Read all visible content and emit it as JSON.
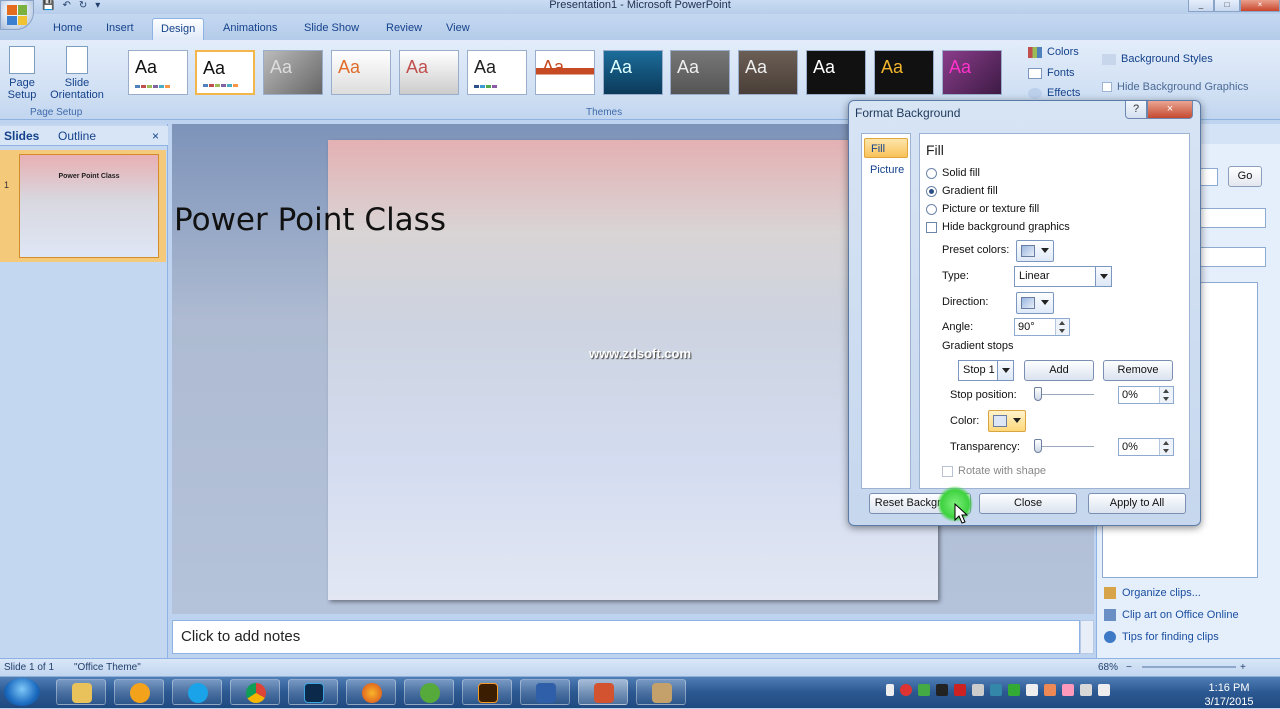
{
  "app": {
    "window_title": "Presentation1 - Microsoft PowerPoint"
  },
  "ribbon": {
    "tabs": [
      {
        "label": "Home"
      },
      {
        "label": "Insert"
      },
      {
        "label": "Design"
      },
      {
        "label": "Animations"
      },
      {
        "label": "Slide Show"
      },
      {
        "label": "Review"
      },
      {
        "label": "View"
      }
    ],
    "active_tab": "Design",
    "page_setup": {
      "page_setup_label_1": "Page",
      "page_setup_label_2": "Setup",
      "orientation_label_1": "Slide",
      "orientation_label_2": "Orientation",
      "group_label": "Page Setup"
    },
    "themes": {
      "group_label": "Themes",
      "sample_text": "Aa"
    },
    "theme_options": {
      "colors": "Colors",
      "fonts": "Fonts",
      "effects": "Effects"
    },
    "background": {
      "styles": "Background Styles",
      "hide_graphics": "Hide Background Graphics"
    }
  },
  "left_panel": {
    "tab_slides": "Slides",
    "tab_outline": "Outline",
    "close": "×",
    "slide_number": "1",
    "thumbnail_title": "Power Point Class"
  },
  "slide": {
    "title": "Power Point Class",
    "watermark": "www.zdsoft.com"
  },
  "notes": {
    "placeholder": "Click to add notes"
  },
  "right_panel": {
    "go_button": "Go",
    "links": [
      {
        "label": "Organize clips..."
      },
      {
        "label": "Clip art on Office Online"
      },
      {
        "label": "Tips for finding clips"
      }
    ]
  },
  "status_bar": {
    "slide_info": "Slide 1 of 1",
    "theme_name": "\"Office Theme\"",
    "zoom": "68%",
    "zoom_minus": "−",
    "zoom_plus": "+"
  },
  "taskbar": {
    "time": "1:16 PM",
    "date": "3/17/2015"
  },
  "dialog": {
    "title": "Format Background",
    "help": "?",
    "close_x": "×",
    "nav": [
      {
        "label": "Fill"
      },
      {
        "label": "Picture"
      }
    ],
    "fill": {
      "heading": "Fill",
      "solid_fill": "Solid fill",
      "gradient_fill": "Gradient fill",
      "picture_texture_fill": "Picture or texture fill",
      "hide_bg_graphics": "Hide background graphics",
      "selected_option": "Gradient fill",
      "preset_colors_label": "Preset colors:",
      "type_label": "Type:",
      "type_value": "Linear",
      "direction_label": "Direction:",
      "angle_label": "Angle:",
      "angle_value": "90°",
      "gradient_stops_label": "Gradient stops",
      "stop_value": "Stop 1",
      "add_button": "Add",
      "remove_button": "Remove",
      "stop_position_label": "Stop position:",
      "stop_position_value": "0%",
      "color_label": "Color:",
      "transparency_label": "Transparency:",
      "transparency_value": "0%",
      "rotate_with_shape": "Rotate with shape"
    },
    "buttons": {
      "reset": "Reset Background",
      "close": "Close",
      "apply_all": "Apply to All"
    }
  },
  "colors": {
    "ribbon_bg": "#cfdff3",
    "selected_orange": "#f9c25a",
    "cursor_highlight": "#3ed23e"
  }
}
